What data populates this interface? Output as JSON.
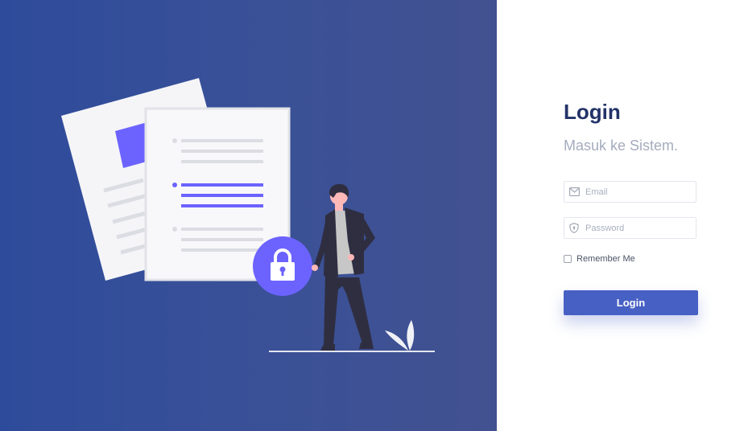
{
  "login": {
    "title": "Login",
    "subtitle": "Masuk ke Sistem.",
    "email_placeholder": "Email",
    "password_placeholder": "Password",
    "remember_label": "Remember Me",
    "remember_checked": false,
    "button_label": "Login"
  },
  "icons": {
    "email": "envelope-icon",
    "password": "shield-icon",
    "illustration_lock": "padlock-icon"
  },
  "colors": {
    "panel_gradient_start": "#2e4b9b",
    "panel_gradient_end": "#425190",
    "accent": "#6c63ff",
    "button": "#4760c4",
    "title": "#233268",
    "subtitle": "#a4acbd"
  }
}
